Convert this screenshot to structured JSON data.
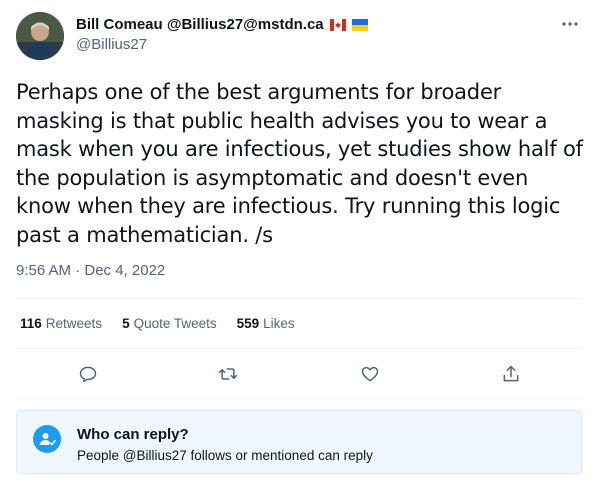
{
  "author": {
    "display_name": "Bill Comeau @Billius27@mstdn.ca",
    "flags": [
      "canada-flag",
      "ukraine-flag"
    ],
    "handle": "@Billius27"
  },
  "tweet": {
    "text": "Perhaps one of the best arguments for broader masking is that public health advises you to wear a mask when you are infectious, yet studies show half of the population is asymptomatic and doesn't even know when they are infectious. Try running this logic past a mathematician. /s",
    "timestamp": "9:56 AM · Dec 4, 2022"
  },
  "stats": {
    "retweets_count": "116",
    "retweets_label": "Retweets",
    "quotes_count": "5",
    "quotes_label": "Quote Tweets",
    "likes_count": "559",
    "likes_label": "Likes"
  },
  "actions": [
    "reply-icon",
    "retweet-icon",
    "like-icon",
    "share-icon"
  ],
  "reply_settings": {
    "title": "Who can reply?",
    "description": "People @Billius27 follows or mentioned can reply"
  },
  "colors": {
    "accent": "#1d9bf0",
    "secondary_text": "#536471",
    "reply_box_bg": "#f0f7fe"
  }
}
